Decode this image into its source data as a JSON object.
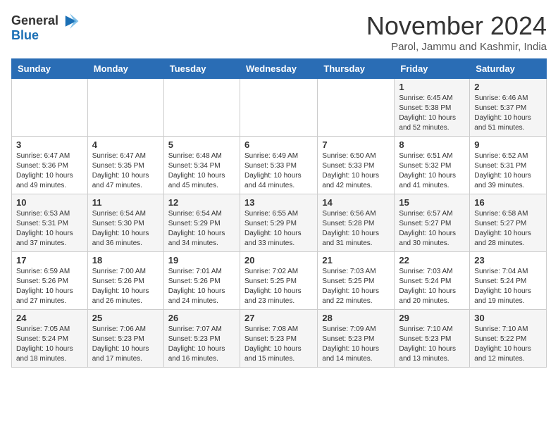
{
  "logo": {
    "line1": "General",
    "line2": "Blue"
  },
  "title": "November 2024",
  "subtitle": "Parol, Jammu and Kashmir, India",
  "days_of_week": [
    "Sunday",
    "Monday",
    "Tuesday",
    "Wednesday",
    "Thursday",
    "Friday",
    "Saturday"
  ],
  "weeks": [
    [
      {
        "day": "",
        "info": ""
      },
      {
        "day": "",
        "info": ""
      },
      {
        "day": "",
        "info": ""
      },
      {
        "day": "",
        "info": ""
      },
      {
        "day": "",
        "info": ""
      },
      {
        "day": "1",
        "info": "Sunrise: 6:45 AM\nSunset: 5:38 PM\nDaylight: 10 hours\nand 52 minutes."
      },
      {
        "day": "2",
        "info": "Sunrise: 6:46 AM\nSunset: 5:37 PM\nDaylight: 10 hours\nand 51 minutes."
      }
    ],
    [
      {
        "day": "3",
        "info": "Sunrise: 6:47 AM\nSunset: 5:36 PM\nDaylight: 10 hours\nand 49 minutes."
      },
      {
        "day": "4",
        "info": "Sunrise: 6:47 AM\nSunset: 5:35 PM\nDaylight: 10 hours\nand 47 minutes."
      },
      {
        "day": "5",
        "info": "Sunrise: 6:48 AM\nSunset: 5:34 PM\nDaylight: 10 hours\nand 45 minutes."
      },
      {
        "day": "6",
        "info": "Sunrise: 6:49 AM\nSunset: 5:33 PM\nDaylight: 10 hours\nand 44 minutes."
      },
      {
        "day": "7",
        "info": "Sunrise: 6:50 AM\nSunset: 5:33 PM\nDaylight: 10 hours\nand 42 minutes."
      },
      {
        "day": "8",
        "info": "Sunrise: 6:51 AM\nSunset: 5:32 PM\nDaylight: 10 hours\nand 41 minutes."
      },
      {
        "day": "9",
        "info": "Sunrise: 6:52 AM\nSunset: 5:31 PM\nDaylight: 10 hours\nand 39 minutes."
      }
    ],
    [
      {
        "day": "10",
        "info": "Sunrise: 6:53 AM\nSunset: 5:31 PM\nDaylight: 10 hours\nand 37 minutes."
      },
      {
        "day": "11",
        "info": "Sunrise: 6:54 AM\nSunset: 5:30 PM\nDaylight: 10 hours\nand 36 minutes."
      },
      {
        "day": "12",
        "info": "Sunrise: 6:54 AM\nSunset: 5:29 PM\nDaylight: 10 hours\nand 34 minutes."
      },
      {
        "day": "13",
        "info": "Sunrise: 6:55 AM\nSunset: 5:29 PM\nDaylight: 10 hours\nand 33 minutes."
      },
      {
        "day": "14",
        "info": "Sunrise: 6:56 AM\nSunset: 5:28 PM\nDaylight: 10 hours\nand 31 minutes."
      },
      {
        "day": "15",
        "info": "Sunrise: 6:57 AM\nSunset: 5:27 PM\nDaylight: 10 hours\nand 30 minutes."
      },
      {
        "day": "16",
        "info": "Sunrise: 6:58 AM\nSunset: 5:27 PM\nDaylight: 10 hours\nand 28 minutes."
      }
    ],
    [
      {
        "day": "17",
        "info": "Sunrise: 6:59 AM\nSunset: 5:26 PM\nDaylight: 10 hours\nand 27 minutes."
      },
      {
        "day": "18",
        "info": "Sunrise: 7:00 AM\nSunset: 5:26 PM\nDaylight: 10 hours\nand 26 minutes."
      },
      {
        "day": "19",
        "info": "Sunrise: 7:01 AM\nSunset: 5:26 PM\nDaylight: 10 hours\nand 24 minutes."
      },
      {
        "day": "20",
        "info": "Sunrise: 7:02 AM\nSunset: 5:25 PM\nDaylight: 10 hours\nand 23 minutes."
      },
      {
        "day": "21",
        "info": "Sunrise: 7:03 AM\nSunset: 5:25 PM\nDaylight: 10 hours\nand 22 minutes."
      },
      {
        "day": "22",
        "info": "Sunrise: 7:03 AM\nSunset: 5:24 PM\nDaylight: 10 hours\nand 20 minutes."
      },
      {
        "day": "23",
        "info": "Sunrise: 7:04 AM\nSunset: 5:24 PM\nDaylight: 10 hours\nand 19 minutes."
      }
    ],
    [
      {
        "day": "24",
        "info": "Sunrise: 7:05 AM\nSunset: 5:24 PM\nDaylight: 10 hours\nand 18 minutes."
      },
      {
        "day": "25",
        "info": "Sunrise: 7:06 AM\nSunset: 5:23 PM\nDaylight: 10 hours\nand 17 minutes."
      },
      {
        "day": "26",
        "info": "Sunrise: 7:07 AM\nSunset: 5:23 PM\nDaylight: 10 hours\nand 16 minutes."
      },
      {
        "day": "27",
        "info": "Sunrise: 7:08 AM\nSunset: 5:23 PM\nDaylight: 10 hours\nand 15 minutes."
      },
      {
        "day": "28",
        "info": "Sunrise: 7:09 AM\nSunset: 5:23 PM\nDaylight: 10 hours\nand 14 minutes."
      },
      {
        "day": "29",
        "info": "Sunrise: 7:10 AM\nSunset: 5:23 PM\nDaylight: 10 hours\nand 13 minutes."
      },
      {
        "day": "30",
        "info": "Sunrise: 7:10 AM\nSunset: 5:22 PM\nDaylight: 10 hours\nand 12 minutes."
      }
    ]
  ]
}
